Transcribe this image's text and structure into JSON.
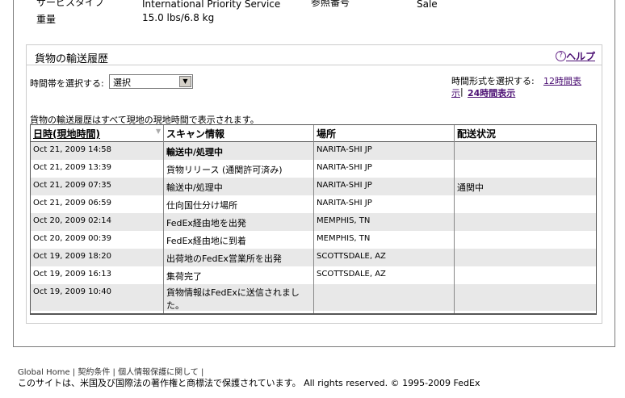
{
  "top": {
    "service_type_label": "サービスタイプ",
    "service_type_value": "International Priority Service",
    "reference_label": "参照番号",
    "reference_value": "Sale",
    "weight_label": "重量",
    "weight_value": "15.0 lbs/6.8 kg"
  },
  "history": {
    "title": "貨物の輸送履歴",
    "help": "ヘルプ",
    "timezone_label": "時間帯を選択する:",
    "timezone_selected": "選択",
    "format_label": "時間形式を選択する:",
    "format_12_part1": "12時間表",
    "format_12_part2": "示",
    "format_24": "24時間表示",
    "note": "貨物の輸送履歴はすべて現地の現地時間で表示されます。",
    "headers": {
      "datetime": "日時(現地時間)",
      "scan": "スキャン情報",
      "location": "場所",
      "status": "配送状況"
    },
    "rows": [
      {
        "datetime": "Oct 21, 2009 14:58",
        "scan": "輸送中/処理中",
        "location": "NARITA-SHI JP",
        "status": ""
      },
      {
        "datetime": "Oct 21, 2009 13:39",
        "scan": "貨物リリース (通関許可済み)",
        "location": "NARITA-SHI JP",
        "status": ""
      },
      {
        "datetime": "Oct 21, 2009 07:35",
        "scan": "輸送中/処理中",
        "location": "NARITA-SHI JP",
        "status": "通関中"
      },
      {
        "datetime": "Oct 21, 2009 06:59",
        "scan": "仕向国仕分け場所",
        "location": "NARITA-SHI JP",
        "status": ""
      },
      {
        "datetime": "Oct 20, 2009 02:14",
        "scan": "FedEx経由地を出発",
        "location": "MEMPHIS, TN",
        "status": ""
      },
      {
        "datetime": "Oct 20, 2009 00:39",
        "scan": "FedEx経由地に到着",
        "location": "MEMPHIS, TN",
        "status": ""
      },
      {
        "datetime": "Oct 19, 2009 18:20",
        "scan": "出荷地のFedEx営業所を出発",
        "location": "SCOTTSDALE, AZ",
        "status": ""
      },
      {
        "datetime": "Oct 19, 2009 16:13",
        "scan": "集荷完了",
        "location": "SCOTTSDALE, AZ",
        "status": ""
      },
      {
        "datetime": "Oct 19, 2009 10:40",
        "scan": "貨物情報はFedExに送信されました。",
        "location": "",
        "status": ""
      }
    ]
  },
  "footer": {
    "global_home": "Global Home",
    "sep": "|",
    "terms": "契約条件",
    "privacy": "個人情報保護に関して",
    "copyright": "このサイトは、米国及び国際法の著作権と商標法で保護されています。 All rights reserved. © 1995-2009 FedEx"
  }
}
